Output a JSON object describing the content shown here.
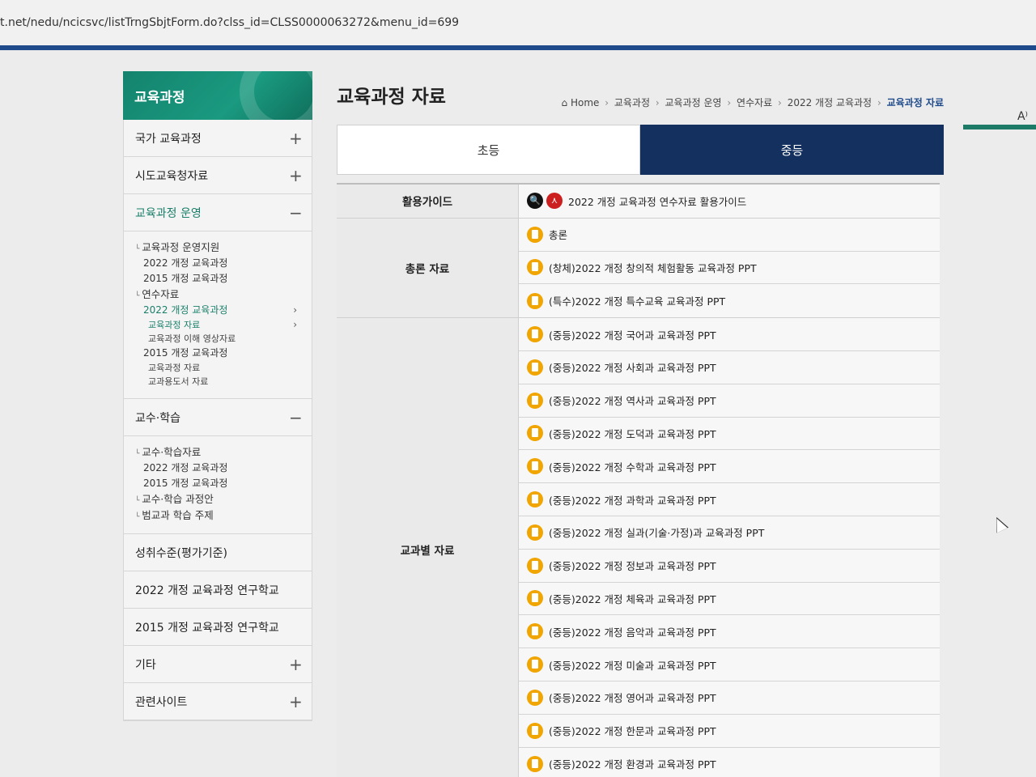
{
  "browser": {
    "url": "t.net/nedu/ncicsvc/listTrngSbjtForm.do?clss_id=CLSS0000063272&menu_id=699",
    "zoom_label": "A⁾"
  },
  "sidebar": {
    "title": "교육과정",
    "items": [
      {
        "label": "국가 교육과정",
        "toggle": "+"
      },
      {
        "label": "시도교육청자료",
        "toggle": "+"
      },
      {
        "label": "교육과정 운영",
        "toggle": "−"
      }
    ],
    "sub_operation": [
      {
        "level": 1,
        "label": "교육과정 운영지원"
      },
      {
        "level": 2,
        "label": "2022 개정 교육과정"
      },
      {
        "level": 2,
        "label": "2015 개정 교육과정"
      },
      {
        "level": 1,
        "label": "연수자료"
      },
      {
        "level": 2,
        "label": "2022 개정 교육과정",
        "active": true,
        "arrow": "›"
      },
      {
        "level": 3,
        "label": "교육과정 자료",
        "active": true,
        "arrow": "›"
      },
      {
        "level": 3,
        "label": "교육과정 이해 영상자료"
      },
      {
        "level": 2,
        "label": "2015 개정 교육과정"
      },
      {
        "level": 3,
        "label": "교육과정 자료"
      },
      {
        "level": 3,
        "label": "교과용도서 자료"
      }
    ],
    "teaching": {
      "label": "교수·학습",
      "toggle": "−"
    },
    "sub_teaching": [
      {
        "level": 1,
        "label": "교수·학습자료"
      },
      {
        "level": 2,
        "label": "2022 개정 교육과정"
      },
      {
        "level": 2,
        "label": "2015 개정 교육과정"
      },
      {
        "level": 1,
        "label": "교수·학습 과정안"
      },
      {
        "level": 1,
        "label": "범교과 학습 주제"
      }
    ],
    "bottom_items": [
      {
        "label": "성취수준(평가기준)",
        "toggle": ""
      },
      {
        "label": "2022 개정 교육과정 연구학교",
        "toggle": ""
      },
      {
        "label": "2015 개정 교육과정 연구학교",
        "toggle": ""
      },
      {
        "label": "기타",
        "toggle": "+"
      },
      {
        "label": "관련사이트",
        "toggle": "+"
      }
    ]
  },
  "main": {
    "title": "교육과정 자료",
    "breadcrumb": [
      "Home",
      "교육과정",
      "교육과정 운영",
      "연수자료",
      "2022 개정 교육과정",
      "교육과정 자료"
    ],
    "breadcrumb_sep": "›",
    "home_icon": "⌂",
    "tabs": [
      "초등",
      "중등"
    ],
    "active_tab": "중등"
  },
  "table": {
    "guide": {
      "label": "활용가이드",
      "view_icon_glyph": "🔍",
      "pdf_icon_glyph": "⋏",
      "item": "2022 개정 교육과정 연수자료 활용가이드"
    },
    "general": {
      "label": "총론 자료",
      "items": [
        "총론",
        "(창체)2022 개정 창의적 체험활동 교육과정 PPT",
        "(특수)2022 개정 특수교육 교육과정 PPT"
      ]
    },
    "subject": {
      "label": "교과별 자료",
      "items": [
        "(중등)2022 개정 국어과 교육과정 PPT",
        "(중등)2022 개정 사회과 교육과정 PPT",
        "(중등)2022 개정 역사과 교육과정 PPT",
        "(중등)2022 개정 도덕과 교육과정 PPT",
        "(중등)2022 개정 수학과 교육과정 PPT",
        "(중등)2022 개정 과학과 교육과정 PPT",
        "(중등)2022 개정 실과(기술·가정)과 교육과정 PPT",
        "(중등)2022 개정 정보과 교육과정 PPT",
        "(중등)2022 개정 체육과 교육과정 PPT",
        "(중등)2022 개정 음악과 교육과정 PPT",
        "(중등)2022 개정 미술과 교육과정 PPT",
        "(중등)2022 개정 영어과 교육과정 PPT",
        "(중등)2022 개정 한문과 교육과정 PPT",
        "(중등)2022 개정 환경과 교육과정 PPT"
      ]
    }
  }
}
